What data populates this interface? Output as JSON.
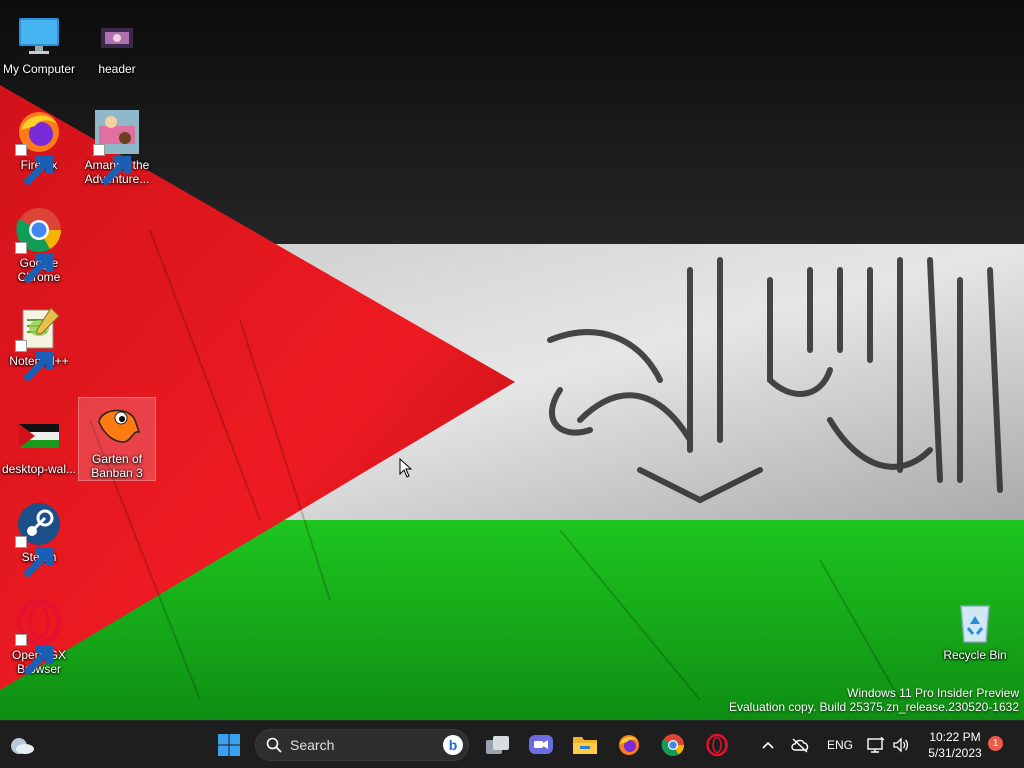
{
  "desktop": {
    "icons": [
      {
        "label": "My Computer"
      },
      {
        "label": "header"
      },
      {
        "label": "Firefox"
      },
      {
        "label": "Amanda the Adventure..."
      },
      {
        "label": "Google Chrome"
      },
      {
        "label": "Notepad++"
      },
      {
        "label": "desktop-wal..."
      },
      {
        "label": "Garten of Banban 3"
      },
      {
        "label": "Steam"
      },
      {
        "label": "Opera GX Browser"
      },
      {
        "label": "Recycle Bin"
      }
    ]
  },
  "watermark": {
    "line1": "Windows 11 Pro Insider Preview",
    "line2": "Evaluation copy. Build 25375.zn_release.230520-1632"
  },
  "taskbar": {
    "search_placeholder": "Search",
    "pinned": [
      "start-icon",
      "search-icon",
      "task-view-icon",
      "chat-icon",
      "file-explorer-icon",
      "firefox-icon",
      "chrome-icon",
      "opera-icon"
    ],
    "tray": {
      "language": "ENG",
      "time": "10:22 PM",
      "date": "5/31/2023",
      "notification_count": "1"
    }
  },
  "colors": {
    "flag_red": "#e0141c",
    "flag_white": "#d8d8d8",
    "flag_green": "#17b21a",
    "flag_black": "#141414",
    "taskbar_bg": "#1e1e1e",
    "badge": "#f05a4a"
  }
}
